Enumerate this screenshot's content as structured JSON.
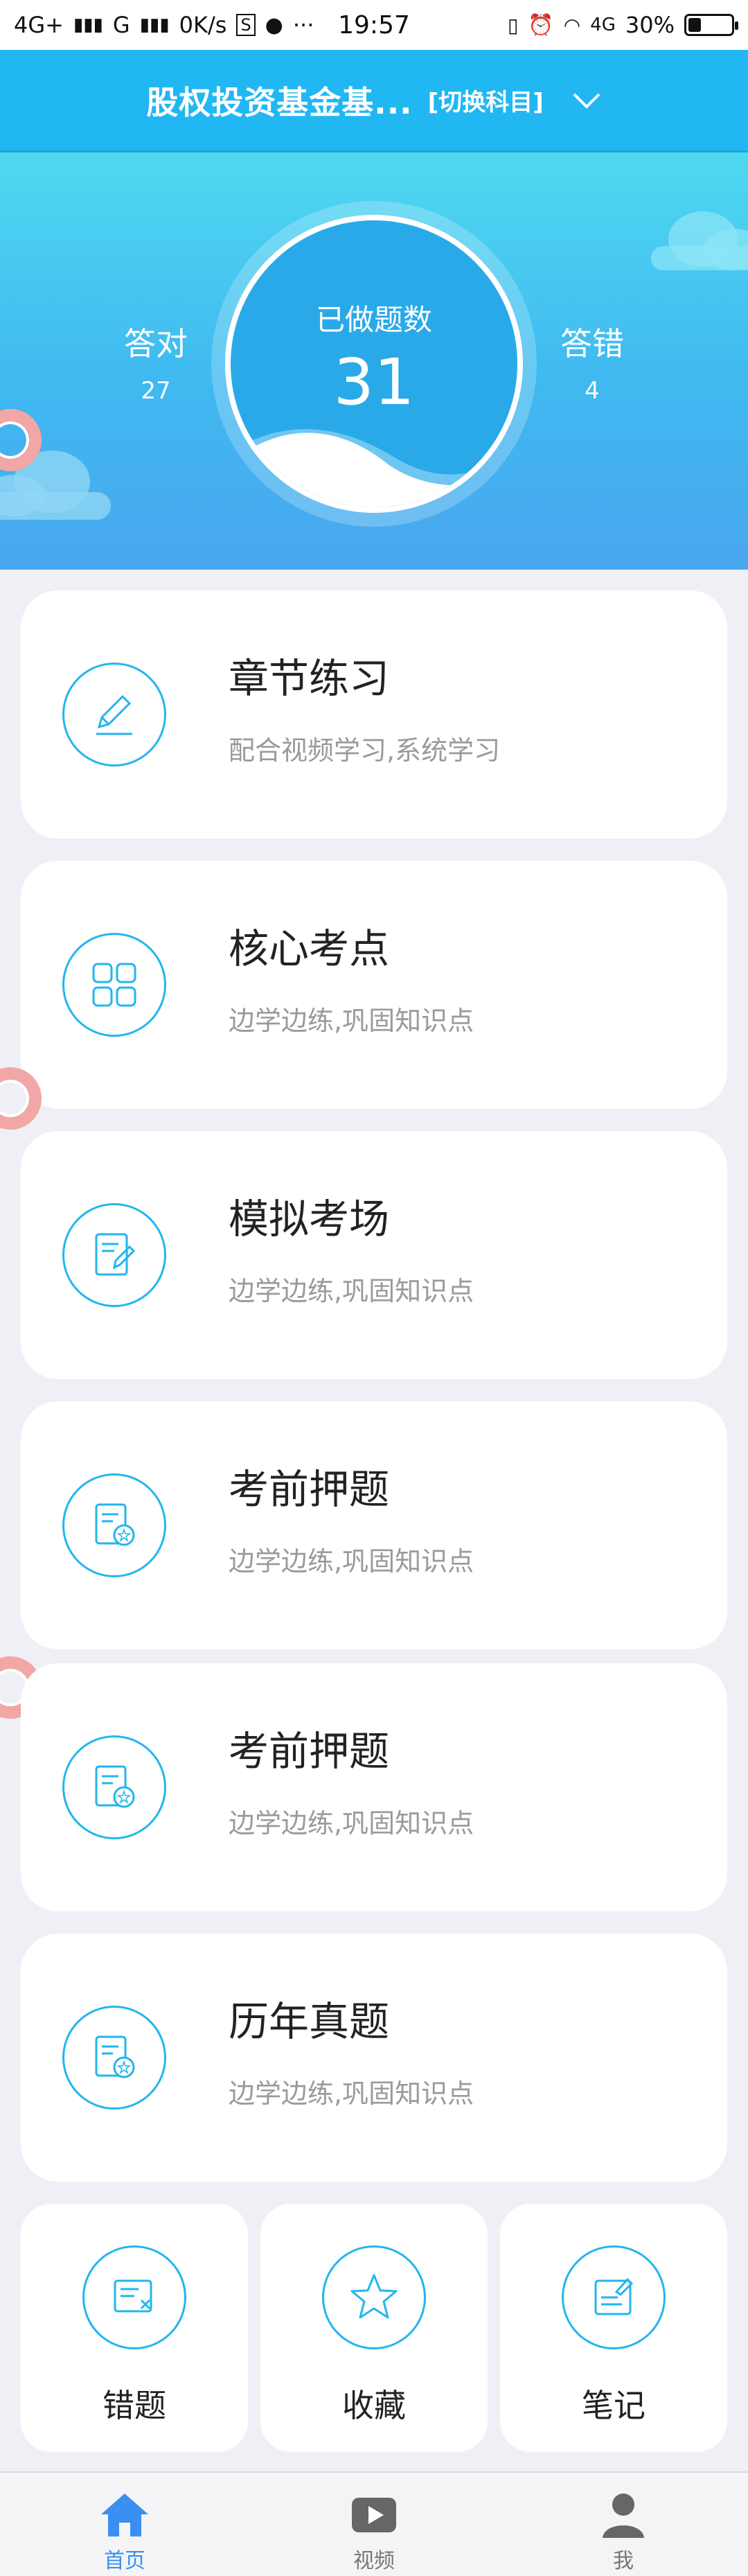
{
  "status_bar": {
    "left": [
      "4G+",
      "G",
      "0K/s",
      "S",
      "···"
    ],
    "time": "19:57",
    "network": "4G",
    "battery": "30%",
    "battery_level": 0.3
  },
  "header": {
    "title": "股权投资基金基...",
    "switch_label": "[切换科目]"
  },
  "hero": {
    "correct_label": "答对",
    "correct_value": "27",
    "done_label": "已做题数",
    "done_value": "31",
    "wrong_label": "答错",
    "wrong_value": "4"
  },
  "modules": [
    {
      "title": "章节练习",
      "subtitle": "配合视频学习,系统学习",
      "icon": "pencil-icon"
    },
    {
      "title": "核心考点",
      "subtitle": "边学边练,巩固知识点",
      "icon": "grid-icon"
    },
    {
      "title": "模拟考场",
      "subtitle": "边学边练,巩固知识点",
      "icon": "edit-doc-icon"
    },
    {
      "title": "考前押题",
      "subtitle": "边学边练,巩固知识点",
      "icon": "doc-badge-icon"
    },
    {
      "title": "考前押题",
      "subtitle": "边学边练,巩固知识点",
      "icon": "doc-badge-icon"
    },
    {
      "title": "历年真题",
      "subtitle": "边学边练,巩固知识点",
      "icon": "doc-badge-icon"
    }
  ],
  "quick": [
    {
      "label": "错题",
      "icon": "wrong-doc-icon"
    },
    {
      "label": "收藏",
      "icon": "star-icon"
    },
    {
      "label": "笔记",
      "icon": "note-icon"
    }
  ],
  "tabs": [
    {
      "label": "首页",
      "icon": "home-icon",
      "active": true
    },
    {
      "label": "视频",
      "icon": "video-icon",
      "active": false
    },
    {
      "label": "我",
      "icon": "user-icon",
      "active": false
    }
  ],
  "colors": {
    "accent": "#22b6ee",
    "header": "#21b7f2",
    "tab_active": "#3a8ff0"
  }
}
